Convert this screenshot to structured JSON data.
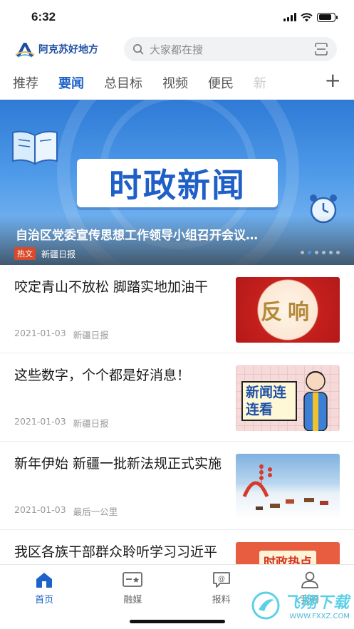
{
  "status_bar": {
    "time": "6:32"
  },
  "header": {
    "logo_text": "阿克苏好地方",
    "search_placeholder": "大家都在搜"
  },
  "tabs": [
    {
      "label": "推荐"
    },
    {
      "label": "要闻",
      "active": true
    },
    {
      "label": "总目标"
    },
    {
      "label": "视频"
    },
    {
      "label": "便民"
    },
    {
      "label": "新"
    }
  ],
  "tab_add": "+",
  "banner": {
    "headline": "时政新闻",
    "title": "自治区党委宣传思想工作领导小组召开会议…",
    "tag": "热文",
    "source": "新疆日报",
    "dot_count": 6,
    "active_dot": 1
  },
  "news": [
    {
      "title": "咬定青山不放松 脚踏实地加油干",
      "date": "2021-01-03",
      "source": "新疆日报",
      "thumb_text": "反响"
    },
    {
      "title": "这些数字，个个都是好消息！",
      "date": "2021-01-03",
      "source": "新疆日报",
      "thumb_text": "新闻连连看"
    },
    {
      "title": "新年伊始 新疆一批新法规正式实施",
      "date": "2021-01-03",
      "source": "最后一公里",
      "thumb_text": ""
    },
    {
      "title": "我区各族干部群众聆听学习习近平主席新年贺词 ……高涛",
      "date": "",
      "source": "",
      "thumb_text": "时政热点"
    }
  ],
  "bottom_nav": [
    {
      "label": "首页",
      "icon": "home-icon",
      "active": true
    },
    {
      "label": "融媒",
      "icon": "media-icon"
    },
    {
      "label": "报料",
      "icon": "report-icon"
    },
    {
      "label": "我的",
      "icon": "user-icon"
    }
  ],
  "watermark": {
    "text": "飞翔下载",
    "url": "WWW.FXXZ.COM"
  },
  "colors": {
    "accent": "#1e63c9",
    "hot": "#d94a2b"
  }
}
